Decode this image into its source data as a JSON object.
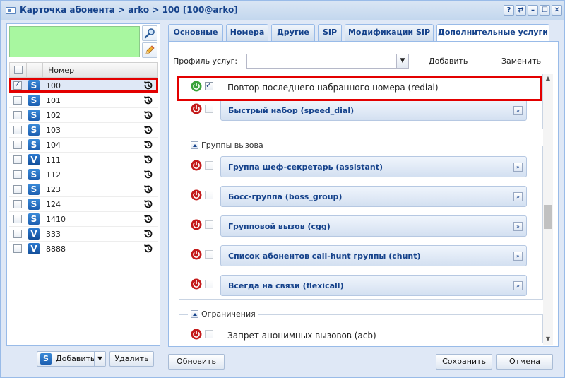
{
  "window": {
    "title": "Карточка абонента > arko > 100 [100@arko]",
    "tools": [
      "?",
      "⇄",
      "–",
      "☐",
      "✕"
    ]
  },
  "left": {
    "grid_header": "Номер",
    "rows": [
      {
        "type": "S",
        "number": "100",
        "checked": true
      },
      {
        "type": "S",
        "number": "101",
        "checked": false
      },
      {
        "type": "S",
        "number": "102",
        "checked": false
      },
      {
        "type": "S",
        "number": "103",
        "checked": false
      },
      {
        "type": "S",
        "number": "104",
        "checked": false
      },
      {
        "type": "V",
        "number": "111",
        "checked": false
      },
      {
        "type": "S",
        "number": "112",
        "checked": false
      },
      {
        "type": "S",
        "number": "123",
        "checked": false
      },
      {
        "type": "S",
        "number": "124",
        "checked": false
      },
      {
        "type": "S",
        "number": "1410",
        "checked": false
      },
      {
        "type": "V",
        "number": "333",
        "checked": false
      },
      {
        "type": "V",
        "number": "8888",
        "checked": false
      }
    ],
    "add_label": "Добавить",
    "delete_label": "Удалить"
  },
  "tabs": [
    {
      "label": "Основные",
      "active": false
    },
    {
      "label": "Номера",
      "active": false
    },
    {
      "label": "Другие",
      "active": false
    },
    {
      "label": "SIP",
      "active": false
    },
    {
      "label": "Модификации SIP",
      "active": false
    },
    {
      "label": "Дополнительные услуги",
      "active": true
    }
  ],
  "profile": {
    "label": "Профиль услуг:",
    "value": "",
    "add_label": "Добавить",
    "replace_label": "Заменить"
  },
  "services": {
    "redial": {
      "label": "Повтор последнего набранного номера (redial)",
      "enabled": true,
      "checked": true
    },
    "speed_dial": {
      "label": "Быстрый набор (speed_dial)",
      "enabled": false,
      "checked": false
    }
  },
  "groups": {
    "legend": "Группы вызова",
    "items": [
      {
        "label": "Группа шеф-секретарь (assistant)"
      },
      {
        "label": "Босс-группа (boss_group)"
      },
      {
        "label": "Групповой вызов (cgg)"
      },
      {
        "label": "Список абонентов call-hunt группы (chunt)"
      },
      {
        "label": "Всегда на связи (flexicall)"
      }
    ]
  },
  "restrictions": {
    "legend": "Ограничения",
    "items": [
      {
        "label": "Запрет анонимных вызовов (acb)"
      }
    ]
  },
  "footer": {
    "refresh_label": "Обновить",
    "save_label": "Сохранить",
    "cancel_label": "Отмена"
  },
  "colors": {
    "header_text": "#15428b",
    "highlight": "#e30000",
    "power_on": "#3aa23a",
    "power_off": "#c41a1a"
  }
}
